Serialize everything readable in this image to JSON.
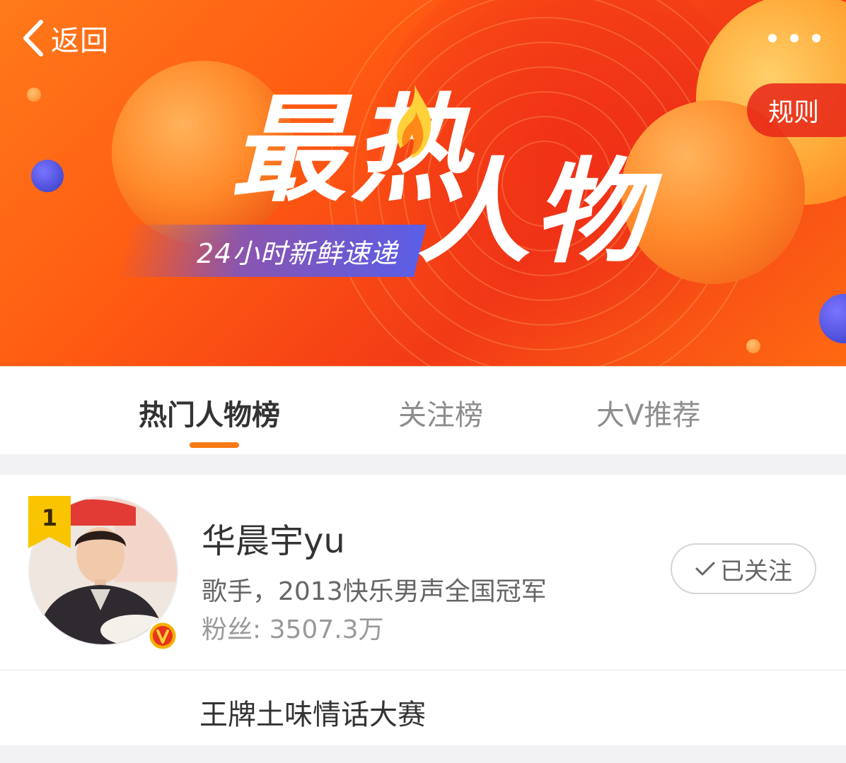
{
  "nav": {
    "back_label": "返回",
    "rules_label": "规则"
  },
  "banner": {
    "title_part1": "最热",
    "title_part2": "人物",
    "slogan": "24小时新鲜速递"
  },
  "tabs": [
    {
      "label": "热门人物榜",
      "active": true
    },
    {
      "label": "关注榜",
      "active": false
    },
    {
      "label": "大V推荐",
      "active": false
    }
  ],
  "list": [
    {
      "rank": "1",
      "name": "华晨宇yu",
      "description": "歌手，2013快乐男声全国冠军",
      "fans": "粉丝: 3507.3万",
      "follow_label": "已关注",
      "verified": true,
      "subtitle": "王牌土味情话大赛"
    }
  ],
  "colors": {
    "accent": "#f77a14",
    "banner_red": "#f23a16",
    "banner_orange": "#ff7a1a",
    "slogan_blue": "#5b5ee6",
    "rank_gold": "#f9c500"
  },
  "icons": [
    "back-chevron-icon",
    "more-dots-icon",
    "flame-icon",
    "checkmark-icon",
    "verified-v-icon",
    "rank-ribbon-icon"
  ]
}
